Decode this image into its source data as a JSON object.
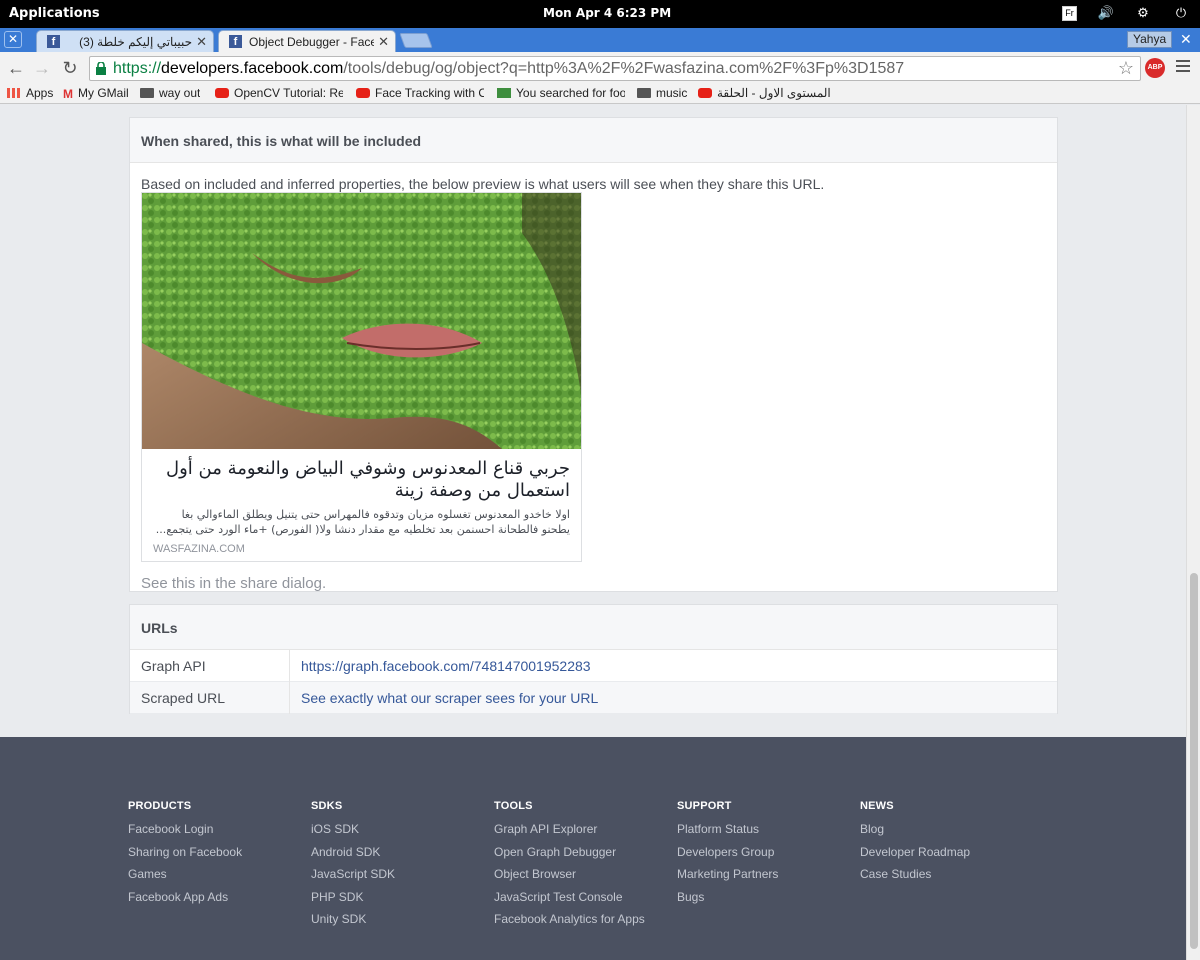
{
  "topbar": {
    "applications": "Applications",
    "clock": "Mon Apr  4   6:23 PM",
    "keyboard_layout": "Fr",
    "tray_icons": [
      "volume-icon",
      "network-icon",
      "power-icon"
    ]
  },
  "tabs": [
    {
      "title": "حبيباتي إليكم خلطة (3)",
      "active": false
    },
    {
      "title": "Object Debugger - Facebook",
      "active": true
    }
  ],
  "user": "Yahya",
  "omnibox": {
    "scheme": "https://",
    "host": "developers.facebook.com",
    "path": "/tools/debug/og/object?q=http%3A%2F%2Fwasfazina.com%2F%3Fp%3D1587"
  },
  "extension": "ABP",
  "bookmarks": [
    {
      "label": "Apps",
      "icon": "grid"
    },
    {
      "label": "My GMail",
      "icon": "gm"
    },
    {
      "label": "way out",
      "icon": "folder"
    },
    {
      "label": "OpenCV Tutorial: Real",
      "icon": "yt"
    },
    {
      "label": "Face Tracking with Op",
      "icon": "yt"
    },
    {
      "label": "You searched for food",
      "icon": "gr"
    },
    {
      "label": "music",
      "icon": "folder"
    },
    {
      "label": "المستوى الاول - الحلقة",
      "icon": "yt"
    }
  ],
  "share": {
    "heading": "When shared, this is what will be included",
    "description": "Based on included and inferred properties, the below preview is what users will see when they share this URL.",
    "preview": {
      "title": "جربي قناع المعدنوس وشوفي البياض والنعومة من أول استعمال من وصفة زينة",
      "description": "اولا خاخدو المعدنوس تغسلوه مزيان وتدقوه فالمهراس حتى يتنيل ويطلق الماءوالي بغا يطحنو فالطحانة احسنمن بعد تخلطيه مع مقدار دنشا ولا( الفورص) +ماء الورد حتى يتجمع...",
      "domain": "WASFAZINA.COM"
    },
    "dialog_link": "See this in the share dialog."
  },
  "urls": {
    "heading": "URLs",
    "rows": [
      {
        "key": "Graph API",
        "value": "https://graph.facebook.com/748147001952283"
      },
      {
        "key": "Scraped URL",
        "value": "See exactly what our scraper sees for your URL"
      }
    ]
  },
  "footer": {
    "columns": [
      {
        "heading": "PRODUCTS",
        "links": [
          "Facebook Login",
          "Sharing on Facebook",
          "Games",
          "Facebook App Ads"
        ]
      },
      {
        "heading": "SDKS",
        "links": [
          "iOS SDK",
          "Android SDK",
          "JavaScript SDK",
          "PHP SDK",
          "Unity SDK"
        ]
      },
      {
        "heading": "TOOLS",
        "links": [
          "Graph API Explorer",
          "Open Graph Debugger",
          "Object Browser",
          "JavaScript Test Console",
          "Facebook Analytics for Apps"
        ]
      },
      {
        "heading": "SUPPORT",
        "links": [
          "Platform Status",
          "Developers Group",
          "Marketing Partners",
          "Bugs"
        ]
      },
      {
        "heading": "NEWS",
        "links": [
          "Blog",
          "Developer Roadmap",
          "Case Studies"
        ]
      }
    ]
  }
}
